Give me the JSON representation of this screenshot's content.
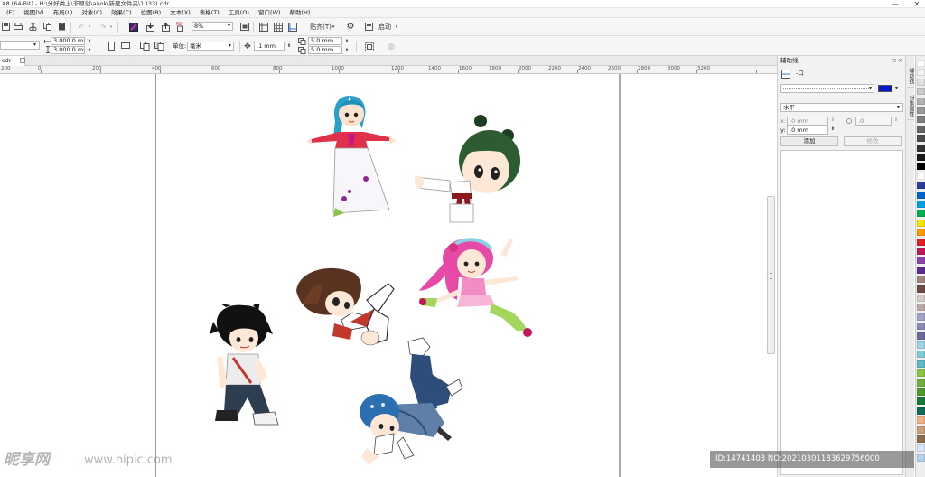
{
  "window": {
    "title": "X8 (64-Bit) - H:\\分好类上\\非原创\\ai\\ok\\新建文件夹\\1 (33).cdr",
    "minimize": "—",
    "close": "✕"
  },
  "menu": [
    "(E)",
    "视图(V)",
    "布局(L)",
    "对象(C)",
    "效果(C)",
    "位图(B)",
    "文本(X)",
    "表格(T)",
    "工具(O)",
    "窗口(W)",
    "帮助(H)"
  ],
  "toolbar": {
    "zoom_value": "8%",
    "snap_label": "贴齐(T)",
    "launch_label": "启动"
  },
  "propbar": {
    "width_value": "3,000.0 mm",
    "height_value": "3,000.0 mm",
    "unit_label": "单位:",
    "unit_value": "毫米",
    "nudge_value": ".1 mm",
    "dup_x_value": "5.0 mm",
    "dup_y_value": "5.0 mm"
  },
  "document_tab": {
    "label": "cdr"
  },
  "ruler": {
    "ticks": [
      "200",
      "0",
      "200",
      "400",
      "600",
      "800",
      "1000",
      "1200",
      "1400",
      "1600",
      "1800",
      "2000",
      "2200",
      "2400",
      "2600",
      "2800",
      "3000",
      "3200"
    ]
  },
  "docker": {
    "title": "辅助线",
    "line_type_icon_label": "-口",
    "color_label": "",
    "orientation_value": "水平",
    "x_field_value": ".0 mm",
    "y_field_value": ".0 mm",
    "angle_field_value": ".0",
    "x_label": "x:",
    "y_label": "y:",
    "add_button": "添加",
    "modify_button": "修改",
    "docker_controls": "⊟ ✕"
  },
  "sidetabs": [
    "辅助线",
    "对象属性"
  ],
  "palette_colors": [
    "#ffffff",
    "#f2f2f2",
    "#e0e0e0",
    "#cccccc",
    "#b3b3b3",
    "#999999",
    "#808080",
    "#666666",
    "#4d4d4d",
    "#333333",
    "#1a1a1a",
    "#000000",
    "#ffffff",
    "#2b3f9e",
    "#0066cc",
    "#00a0e9",
    "#00b050",
    "#f7e400",
    "#ff9900",
    "#e31e24",
    "#c2185b",
    "#8e44ad",
    "#5d2e8c",
    "#a1887f",
    "#6d4c41",
    "#d7ccc8",
    "#bcaaa4",
    "#a5a5c8",
    "#8a8ab5",
    "#6b6b9e",
    "#9fd3e6",
    "#7ecbd8",
    "#5fb9c9",
    "#8cc63f",
    "#6fb23b",
    "#4e9a2f",
    "#1c7a3a",
    "#0e6b5c",
    "#f4b183",
    "#c9a07a",
    "#8c6d4f",
    "#d9e6f5",
    "#b7d3ea"
  ],
  "watermark": {
    "logo_text": "昵享网",
    "url_text": "www.nipic.com",
    "id_text": "ID:14741403 NO:20210301183629756000"
  }
}
